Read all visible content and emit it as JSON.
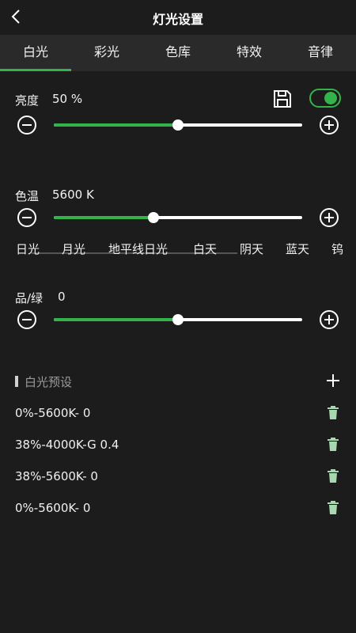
{
  "header": {
    "title": "灯光设置"
  },
  "tabs": [
    {
      "label": "白光"
    },
    {
      "label": "彩光"
    },
    {
      "label": "色库"
    },
    {
      "label": "特效"
    },
    {
      "label": "音律"
    }
  ],
  "brightness": {
    "label": "亮度",
    "value": "50 %",
    "level": 0.5,
    "enabled": true
  },
  "color_temp": {
    "label": "色温",
    "value": "5600 K",
    "level": 0.4
  },
  "presets": [
    "日光",
    "月光",
    "地平线日光",
    "白天",
    "阴天",
    "蓝天",
    "钨"
  ],
  "tint": {
    "label": "品/绿",
    "value": "0",
    "level": 0.5
  },
  "white_presets": {
    "title": "白光预设",
    "items": [
      {
        "name": "0%-5600K- 0"
      },
      {
        "name": "38%-4000K-G 0.4"
      },
      {
        "name": "38%-5600K- 0"
      },
      {
        "name": "0%-5600K- 0"
      }
    ]
  },
  "colors": {
    "accent": "#34b34a",
    "background": "#1c1c1c",
    "tabbar": "#2a2a2a",
    "delete_icon": "#a8d8b0"
  }
}
